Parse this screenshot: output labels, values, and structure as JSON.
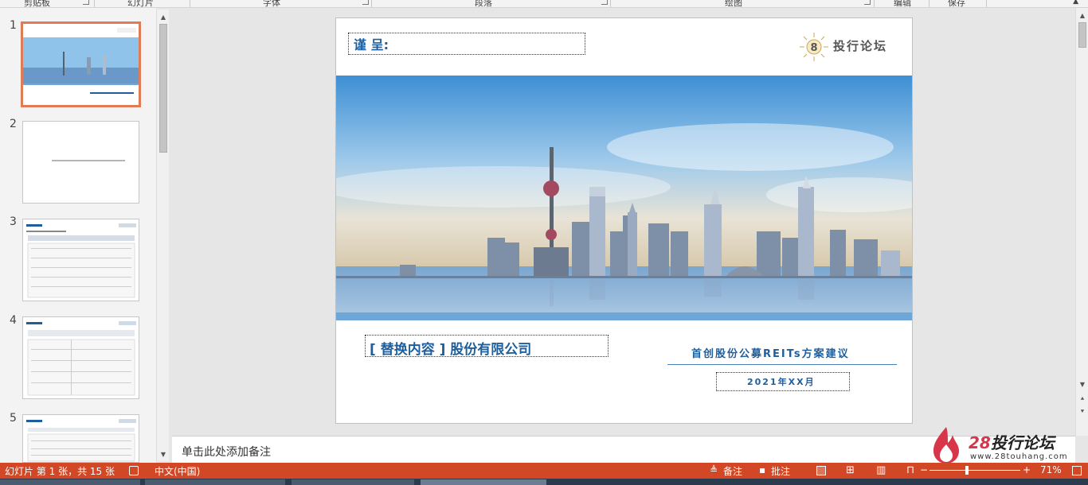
{
  "ribbon": {
    "groups": [
      "剪贴板",
      "幻灯片",
      "字体",
      "段落",
      "绘图",
      "编辑",
      "保存"
    ]
  },
  "thumbnails": {
    "items": [
      {
        "number": "1",
        "selected": true
      },
      {
        "number": "2",
        "selected": false
      },
      {
        "number": "3",
        "selected": false
      },
      {
        "number": "4",
        "selected": false
      },
      {
        "number": "5",
        "selected": false
      }
    ]
  },
  "slide": {
    "presented_label": "谨 呈:",
    "logo_text": "投行论坛",
    "logo_digit": "8",
    "company_name": "[ 替换内容 ] 股份有限公司",
    "proposal_title": "首创股份公募REITs方案建议",
    "date": "2021年XX月"
  },
  "notes": {
    "placeholder": "单击此处添加备注"
  },
  "watermark": {
    "number": "28",
    "text": "投行论坛",
    "url": "www.28touhang.com"
  },
  "status_bar": {
    "slide_info": "幻灯片 第 1 张，共 15 张",
    "language": "中文(中国)",
    "notes_label": "备注",
    "comments_label": "批注",
    "zoom_percent": "71%",
    "zoom_minus": "−",
    "zoom_plus": "+"
  },
  "colors": {
    "accent": "#d24726",
    "title_blue": "#1f5e9c",
    "selection": "#e07b56"
  }
}
